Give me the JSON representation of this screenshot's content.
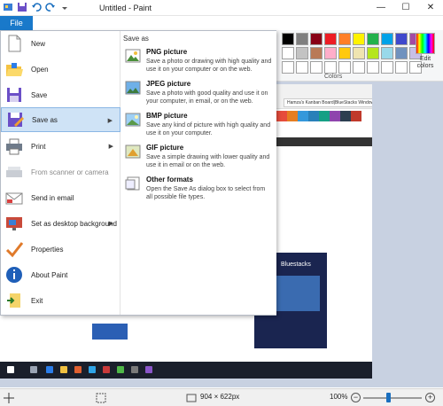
{
  "window": {
    "title": "Untitled - Paint",
    "controls": {
      "minimize": "—",
      "maximize": "☐",
      "close": "✕"
    }
  },
  "ribbon": {
    "file_tab": "File",
    "colors_group_label": "Colors",
    "edit_colors_label": "Edit colors",
    "palette": [
      "#000000",
      "#7f7f7f",
      "#880015",
      "#ed1c24",
      "#ff7f27",
      "#fff200",
      "#22b14c",
      "#00a2e8",
      "#3f48cc",
      "#a349a4",
      "#ffffff",
      "#c3c3c3",
      "#b97a57",
      "#ffaec9",
      "#ffc90e",
      "#efe4b0",
      "#b5e61d",
      "#99d9ea",
      "#7092be",
      "#c8bfe7",
      "#ffffff",
      "#ffffff",
      "#ffffff",
      "#ffffff",
      "#ffffff",
      "#ffffff",
      "#ffffff",
      "#ffffff",
      "#ffffff",
      "#ffffff"
    ]
  },
  "file_menu": {
    "items": [
      {
        "label": "New",
        "icon": "new-file-icon",
        "submenu": false,
        "disabled": false,
        "active": false
      },
      {
        "label": "Open",
        "icon": "open-folder-icon",
        "submenu": false,
        "disabled": false,
        "active": false
      },
      {
        "label": "Save",
        "icon": "save-disk-icon",
        "submenu": false,
        "disabled": false,
        "active": false
      },
      {
        "label": "Save as",
        "icon": "save-as-icon",
        "submenu": true,
        "disabled": false,
        "active": true
      },
      {
        "label": "Print",
        "icon": "printer-icon",
        "submenu": true,
        "disabled": false,
        "active": false
      },
      {
        "label": "From scanner or camera",
        "icon": "scanner-icon",
        "submenu": false,
        "disabled": true,
        "active": false
      },
      {
        "label": "Send in email",
        "icon": "email-icon",
        "submenu": false,
        "disabled": false,
        "active": false
      },
      {
        "label": "Set as desktop background",
        "icon": "desktop-background-icon",
        "submenu": true,
        "disabled": false,
        "active": false
      },
      {
        "label": "Properties",
        "icon": "properties-check-icon",
        "submenu": false,
        "disabled": false,
        "active": false
      },
      {
        "label": "About Paint",
        "icon": "info-icon",
        "submenu": false,
        "disabled": false,
        "active": false
      },
      {
        "label": "Exit",
        "icon": "exit-icon",
        "submenu": false,
        "disabled": false,
        "active": false
      }
    ],
    "save_as": {
      "heading": "Save as",
      "options": [
        {
          "title": "PNG picture",
          "desc": "Save a photo or drawing with high quality and use it on your computer or on the web.",
          "icon": "png-picture-icon"
        },
        {
          "title": "JPEG picture",
          "desc": "Save a photo with good quality and use it on your computer, in email, or on the web.",
          "icon": "jpeg-picture-icon"
        },
        {
          "title": "BMP picture",
          "desc": "Save any kind of picture with high quality and use it on your computer.",
          "icon": "bmp-picture-icon"
        },
        {
          "title": "GIF picture",
          "desc": "Save a simple drawing with lower quality and use it in email or on the web.",
          "icon": "gif-picture-icon"
        },
        {
          "title": "Other formats",
          "desc": "Open the Save As dialog box to select from all possible file types.",
          "icon": "other-formats-icon"
        }
      ]
    }
  },
  "canvas": {
    "browser_url": "Hamza's Kanban Board|BlueStacks Windows |...",
    "panel_title": "Bluestacks"
  },
  "statusbar": {
    "dimensions": "904 × 622px",
    "zoom": "100%",
    "zoom_level": 1.0
  }
}
